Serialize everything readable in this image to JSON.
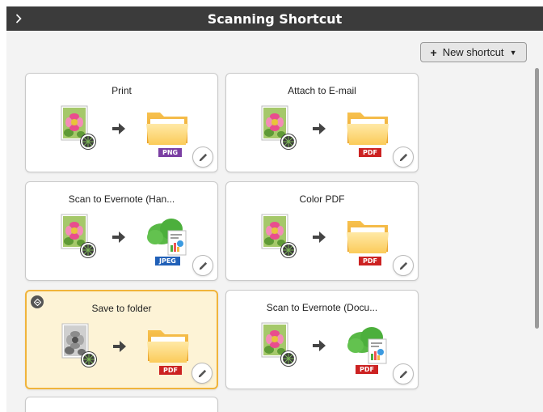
{
  "window": {
    "title": "Scanning Shortcut"
  },
  "toolbar": {
    "new_shortcut_label": "New shortcut"
  },
  "cards": [
    {
      "label": "Print",
      "format": "PNG",
      "format_color": "#7b3fa3",
      "destination": "folder",
      "photo": "color",
      "selected": false
    },
    {
      "label": "Attach to E-mail",
      "format": "PDF",
      "format_color": "#cc2222",
      "destination": "folder",
      "photo": "color",
      "selected": false
    },
    {
      "label": "Scan to Evernote (Han...",
      "format": "JPEG",
      "format_color": "#2060b8",
      "destination": "evernote",
      "photo": "color",
      "selected": false
    },
    {
      "label": "Color PDF",
      "format": "PDF",
      "format_color": "#cc2222",
      "destination": "folder",
      "photo": "color",
      "selected": false
    },
    {
      "label": "Save to folder",
      "format": "PDF",
      "format_color": "#cc2222",
      "destination": "folder",
      "photo": "grayscale",
      "selected": true
    },
    {
      "label": "Scan to Evernote (Docu...",
      "format": "PDF",
      "format_color": "#cc2222",
      "destination": "evernote",
      "photo": "color",
      "selected": false
    }
  ],
  "colors": {
    "titlebar": "#3b3b3b",
    "selected_bg": "#fdf3d6",
    "selected_border": "#f0b43c"
  }
}
